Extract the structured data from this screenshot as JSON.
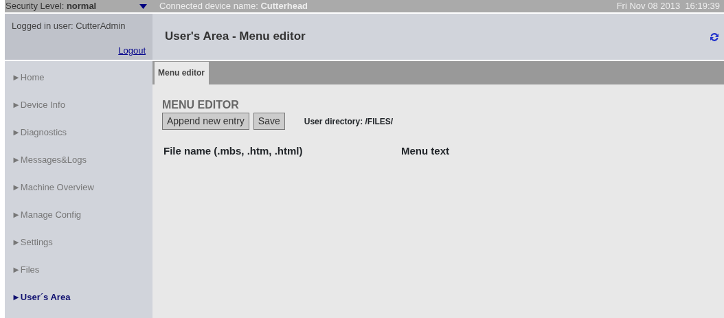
{
  "top_bar": {
    "security_level": "Security Level: **normal**",
    "device": "Connected device name: **Cutterhead**",
    "datetime": "Fri Nov 08 2013  16:19:39"
  },
  "user_panel": {
    "logged_in": "Logged in user: CutterAdmin",
    "logout": "Logout"
  },
  "header": {
    "title": "User's Area - Menu editor"
  },
  "sidebar": {
    "items": [
      {
        "label": "►Home",
        "selected": false
      },
      {
        "label": "►Device Info",
        "selected": false
      },
      {
        "label": "►Diagnostics",
        "selected": false
      },
      {
        "label": "►Messages&Logs",
        "selected": false
      },
      {
        "label": "►Machine Overview",
        "selected": false
      },
      {
        "label": "►Manage Config",
        "selected": false
      },
      {
        "label": "►Settings",
        "selected": false
      },
      {
        "label": "►Files",
        "selected": false
      },
      {
        "label": "►User´s Area",
        "selected": true
      }
    ]
  },
  "tabs": [
    {
      "label": "Menu editor",
      "selected": true
    }
  ],
  "content": {
    "heading": "MENU EDITOR",
    "buttons": [
      "Append new entry",
      "Save"
    ],
    "directory": "User directory: /FILES/",
    "columns": [
      "File name (.mbs, .htm, .html)",
      "Menu text"
    ]
  }
}
